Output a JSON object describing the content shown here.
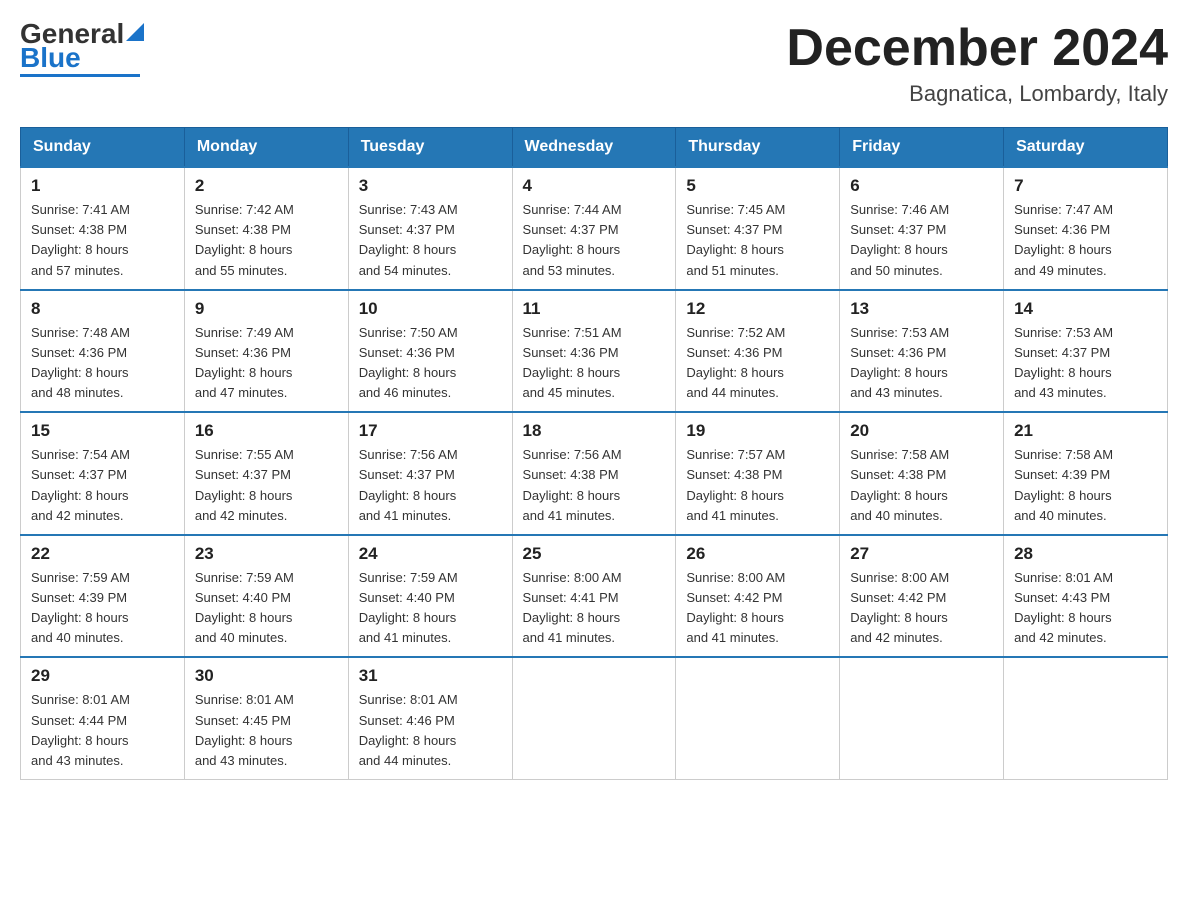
{
  "header": {
    "logo_text_black": "General",
    "logo_text_blue": "Blue",
    "month_title": "December 2024",
    "location": "Bagnatica, Lombardy, Italy"
  },
  "weekdays": [
    "Sunday",
    "Monday",
    "Tuesday",
    "Wednesday",
    "Thursday",
    "Friday",
    "Saturday"
  ],
  "weeks": [
    [
      {
        "day": "1",
        "sunrise": "7:41 AM",
        "sunset": "4:38 PM",
        "daylight": "8 hours and 57 minutes."
      },
      {
        "day": "2",
        "sunrise": "7:42 AM",
        "sunset": "4:38 PM",
        "daylight": "8 hours and 55 minutes."
      },
      {
        "day": "3",
        "sunrise": "7:43 AM",
        "sunset": "4:37 PM",
        "daylight": "8 hours and 54 minutes."
      },
      {
        "day": "4",
        "sunrise": "7:44 AM",
        "sunset": "4:37 PM",
        "daylight": "8 hours and 53 minutes."
      },
      {
        "day": "5",
        "sunrise": "7:45 AM",
        "sunset": "4:37 PM",
        "daylight": "8 hours and 51 minutes."
      },
      {
        "day": "6",
        "sunrise": "7:46 AM",
        "sunset": "4:37 PM",
        "daylight": "8 hours and 50 minutes."
      },
      {
        "day": "7",
        "sunrise": "7:47 AM",
        "sunset": "4:36 PM",
        "daylight": "8 hours and 49 minutes."
      }
    ],
    [
      {
        "day": "8",
        "sunrise": "7:48 AM",
        "sunset": "4:36 PM",
        "daylight": "8 hours and 48 minutes."
      },
      {
        "day": "9",
        "sunrise": "7:49 AM",
        "sunset": "4:36 PM",
        "daylight": "8 hours and 47 minutes."
      },
      {
        "day": "10",
        "sunrise": "7:50 AM",
        "sunset": "4:36 PM",
        "daylight": "8 hours and 46 minutes."
      },
      {
        "day": "11",
        "sunrise": "7:51 AM",
        "sunset": "4:36 PM",
        "daylight": "8 hours and 45 minutes."
      },
      {
        "day": "12",
        "sunrise": "7:52 AM",
        "sunset": "4:36 PM",
        "daylight": "8 hours and 44 minutes."
      },
      {
        "day": "13",
        "sunrise": "7:53 AM",
        "sunset": "4:36 PM",
        "daylight": "8 hours and 43 minutes."
      },
      {
        "day": "14",
        "sunrise": "7:53 AM",
        "sunset": "4:37 PM",
        "daylight": "8 hours and 43 minutes."
      }
    ],
    [
      {
        "day": "15",
        "sunrise": "7:54 AM",
        "sunset": "4:37 PM",
        "daylight": "8 hours and 42 minutes."
      },
      {
        "day": "16",
        "sunrise": "7:55 AM",
        "sunset": "4:37 PM",
        "daylight": "8 hours and 42 minutes."
      },
      {
        "day": "17",
        "sunrise": "7:56 AM",
        "sunset": "4:37 PM",
        "daylight": "8 hours and 41 minutes."
      },
      {
        "day": "18",
        "sunrise": "7:56 AM",
        "sunset": "4:38 PM",
        "daylight": "8 hours and 41 minutes."
      },
      {
        "day": "19",
        "sunrise": "7:57 AM",
        "sunset": "4:38 PM",
        "daylight": "8 hours and 41 minutes."
      },
      {
        "day": "20",
        "sunrise": "7:58 AM",
        "sunset": "4:38 PM",
        "daylight": "8 hours and 40 minutes."
      },
      {
        "day": "21",
        "sunrise": "7:58 AM",
        "sunset": "4:39 PM",
        "daylight": "8 hours and 40 minutes."
      }
    ],
    [
      {
        "day": "22",
        "sunrise": "7:59 AM",
        "sunset": "4:39 PM",
        "daylight": "8 hours and 40 minutes."
      },
      {
        "day": "23",
        "sunrise": "7:59 AM",
        "sunset": "4:40 PM",
        "daylight": "8 hours and 40 minutes."
      },
      {
        "day": "24",
        "sunrise": "7:59 AM",
        "sunset": "4:40 PM",
        "daylight": "8 hours and 41 minutes."
      },
      {
        "day": "25",
        "sunrise": "8:00 AM",
        "sunset": "4:41 PM",
        "daylight": "8 hours and 41 minutes."
      },
      {
        "day": "26",
        "sunrise": "8:00 AM",
        "sunset": "4:42 PM",
        "daylight": "8 hours and 41 minutes."
      },
      {
        "day": "27",
        "sunrise": "8:00 AM",
        "sunset": "4:42 PM",
        "daylight": "8 hours and 42 minutes."
      },
      {
        "day": "28",
        "sunrise": "8:01 AM",
        "sunset": "4:43 PM",
        "daylight": "8 hours and 42 minutes."
      }
    ],
    [
      {
        "day": "29",
        "sunrise": "8:01 AM",
        "sunset": "4:44 PM",
        "daylight": "8 hours and 43 minutes."
      },
      {
        "day": "30",
        "sunrise": "8:01 AM",
        "sunset": "4:45 PM",
        "daylight": "8 hours and 43 minutes."
      },
      {
        "day": "31",
        "sunrise": "8:01 AM",
        "sunset": "4:46 PM",
        "daylight": "8 hours and 44 minutes."
      },
      null,
      null,
      null,
      null
    ]
  ],
  "labels": {
    "sunrise": "Sunrise:",
    "sunset": "Sunset:",
    "daylight": "Daylight:"
  }
}
